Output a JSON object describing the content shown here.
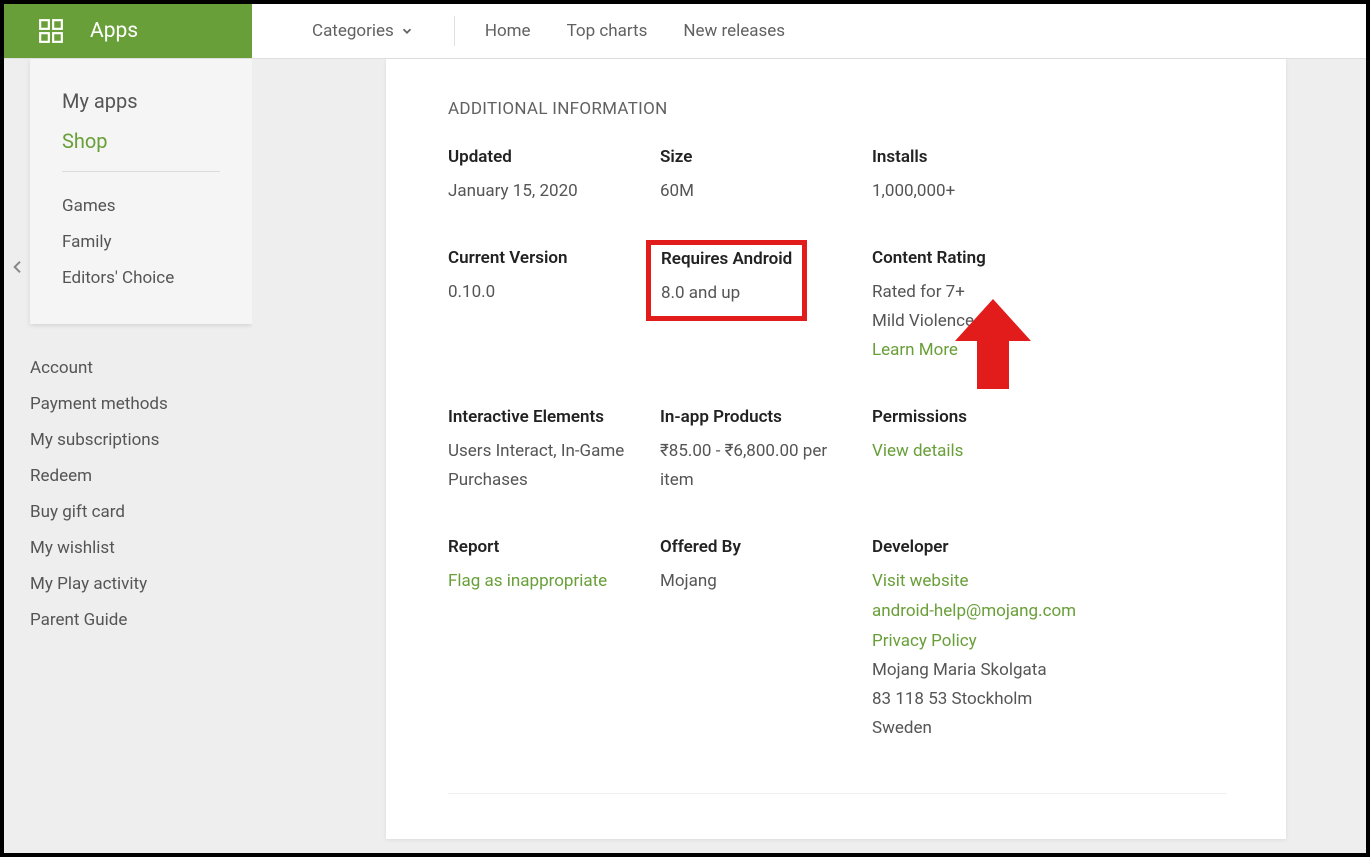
{
  "brand": {
    "label": "Apps"
  },
  "topnav": {
    "categories": "Categories",
    "links": [
      "Home",
      "Top charts",
      "New releases"
    ]
  },
  "sidebar": {
    "primary": [
      {
        "label": "My apps",
        "active": false
      },
      {
        "label": "Shop",
        "active": true
      }
    ],
    "sub": [
      "Games",
      "Family",
      "Editors' Choice"
    ],
    "account": [
      "Account",
      "Payment methods",
      "My subscriptions",
      "Redeem",
      "Buy gift card",
      "My wishlist",
      "My Play activity",
      "Parent Guide"
    ]
  },
  "info": {
    "title": "ADDITIONAL INFORMATION",
    "updated": {
      "label": "Updated",
      "value": "January 15, 2020"
    },
    "size": {
      "label": "Size",
      "value": "60M"
    },
    "installs": {
      "label": "Installs",
      "value": "1,000,000+"
    },
    "version": {
      "label": "Current Version",
      "value": "0.10.0"
    },
    "requires": {
      "label": "Requires Android",
      "value": "8.0 and up"
    },
    "rating": {
      "label": "Content Rating",
      "lines": [
        "Rated for 7+",
        "Mild Violence"
      ],
      "learn": "Learn More"
    },
    "interactive": {
      "label": "Interactive Elements",
      "value": "Users Interact, In-Game Purchases"
    },
    "inapp": {
      "label": "In-app Products",
      "value": "₹85.00 - ₹6,800.00 per item"
    },
    "permissions": {
      "label": "Permissions",
      "link": "View details"
    },
    "report": {
      "label": "Report",
      "link": "Flag as inappropriate"
    },
    "offered": {
      "label": "Offered By",
      "value": "Mojang"
    },
    "developer": {
      "label": "Developer",
      "links": [
        "Visit website",
        "android-help@mojang.com",
        "Privacy Policy"
      ],
      "address": [
        "Mojang Maria Skolgata",
        "83 118 53 Stockholm",
        "Sweden"
      ]
    }
  }
}
